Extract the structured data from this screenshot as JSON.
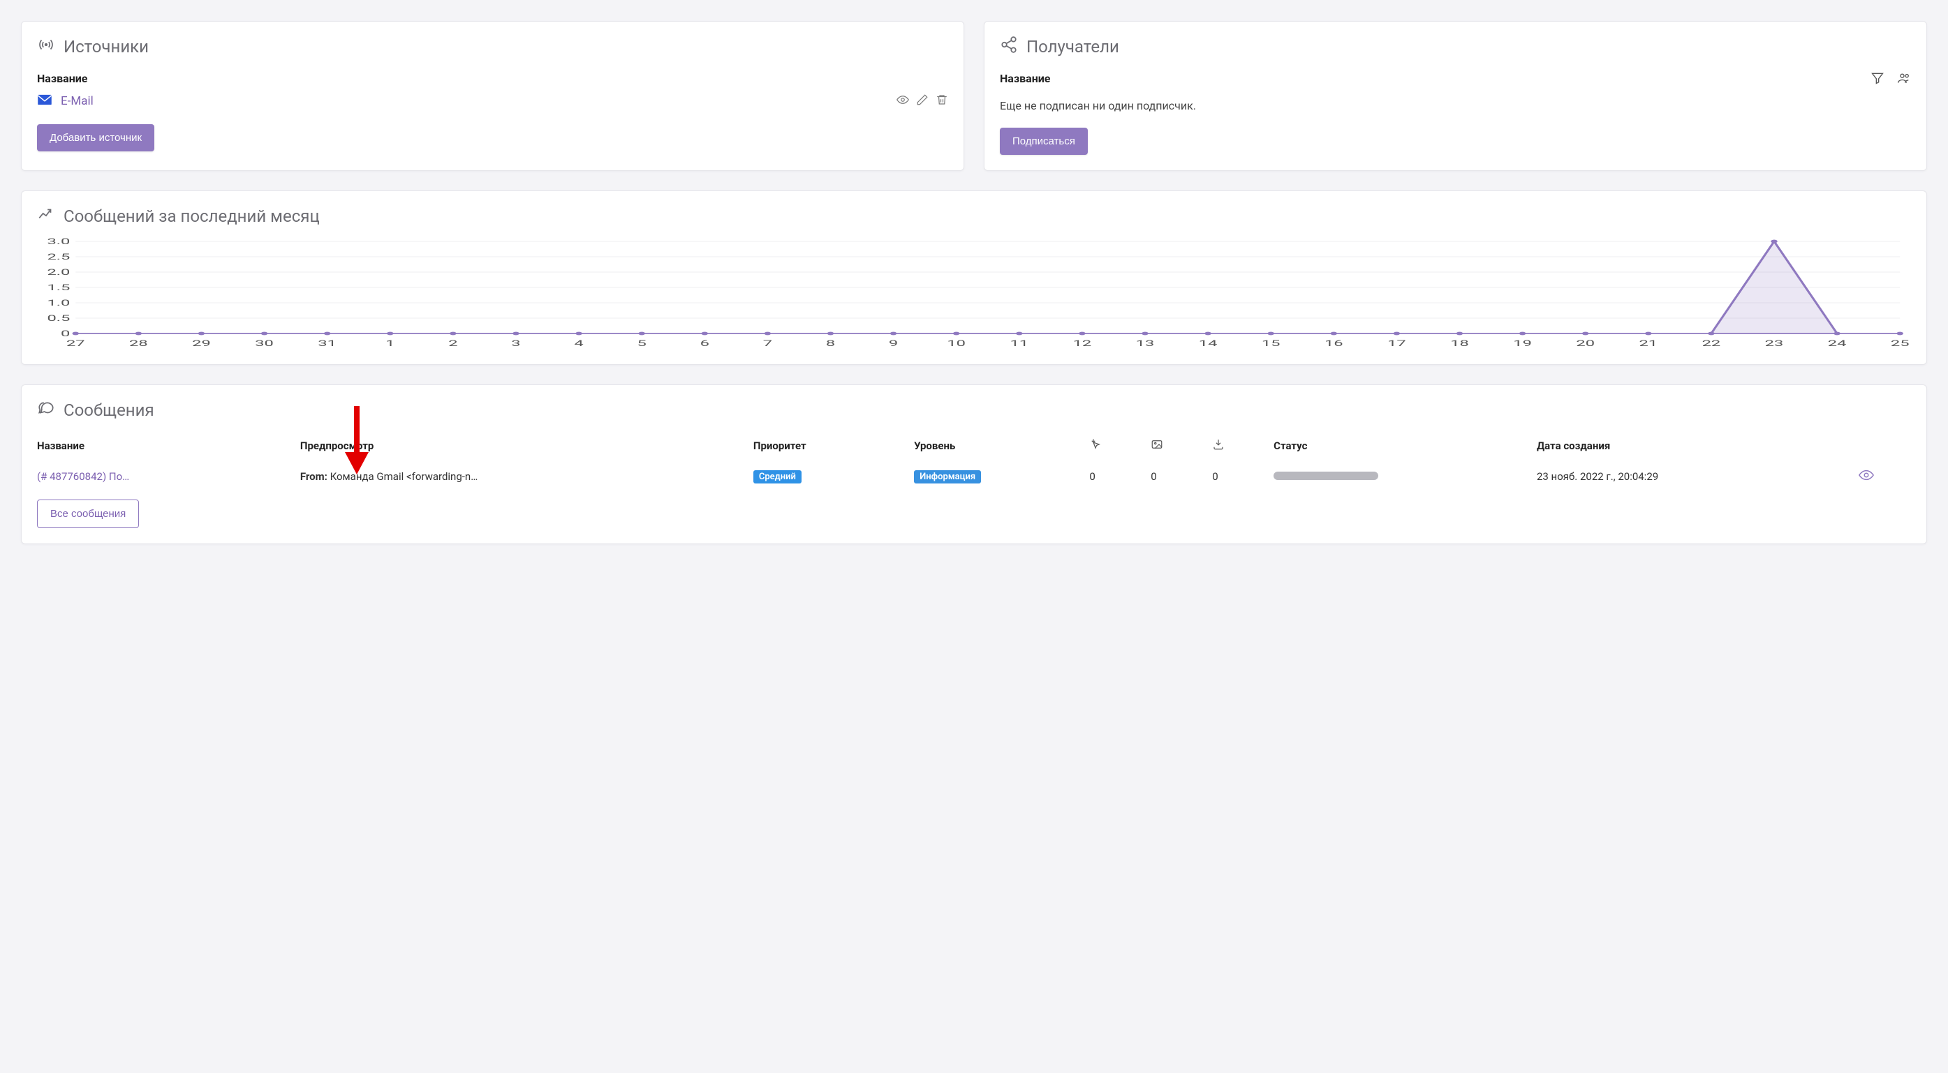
{
  "sources_card": {
    "title": "Источники",
    "column_header": "Название",
    "items": [
      {
        "icon": "mail-icon",
        "label": "E-Mail"
      }
    ],
    "add_button": "Добавить источник"
  },
  "recipients_card": {
    "title": "Получатели",
    "column_header": "Название",
    "empty_message": "Еще не подписан ни один подписчик.",
    "subscribe_button": "Подписаться"
  },
  "chart_card": {
    "title": "Сообщений за последний месяц"
  },
  "chart_data": {
    "type": "area",
    "x": [
      "27",
      "28",
      "29",
      "30",
      "31",
      "1",
      "2",
      "3",
      "4",
      "5",
      "6",
      "7",
      "8",
      "9",
      "10",
      "11",
      "12",
      "13",
      "14",
      "15",
      "16",
      "17",
      "18",
      "19",
      "20",
      "21",
      "22",
      "23",
      "24",
      "25"
    ],
    "values": [
      0,
      0,
      0,
      0,
      0,
      0,
      0,
      0,
      0,
      0,
      0,
      0,
      0,
      0,
      0,
      0,
      0,
      0,
      0,
      0,
      0,
      0,
      0,
      0,
      0,
      0,
      0,
      3,
      0,
      0
    ],
    "ylim": [
      0,
      3
    ],
    "y_ticks": [
      "0",
      "0.5",
      "1.0",
      "1.5",
      "2.0",
      "2.5",
      "3.0"
    ],
    "xlabel": "",
    "ylabel": "",
    "title": ""
  },
  "messages_card": {
    "title": "Сообщения",
    "columns": {
      "name": "Название",
      "preview": "Предпросмотр",
      "priority": "Приоритет",
      "level": "Уровень",
      "status": "Статус",
      "created": "Дата создания"
    },
    "rows": [
      {
        "name": "(# 487760842) По…",
        "preview_prefix": "From:",
        "preview_body": " Команда Gmail <forwarding-n…",
        "priority": "Средний",
        "level": "Информация",
        "count_clicks": "0",
        "count_images": "0",
        "count_downloads": "0",
        "created": "23 нояб. 2022 г., 20:04:29"
      }
    ],
    "all_button": "Все сообщения"
  }
}
